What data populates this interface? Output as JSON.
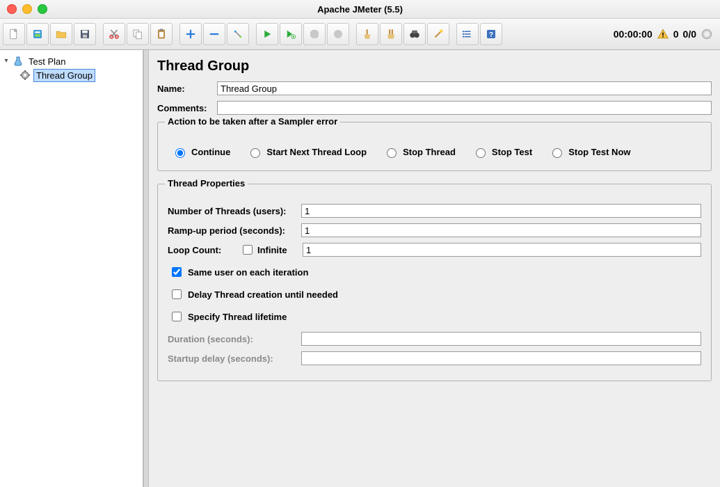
{
  "window": {
    "title": "Apache JMeter (5.5)"
  },
  "status": {
    "elapsed": "00:00:00",
    "warnings": "0",
    "threads": "0/0"
  },
  "tree": {
    "root": {
      "label": "Test Plan",
      "children": [
        {
          "label": "Thread Group"
        }
      ]
    }
  },
  "page": {
    "title": "Thread Group",
    "name_label": "Name:",
    "name_value": "Thread Group",
    "comments_label": "Comments:",
    "comments_value": "",
    "error_group": {
      "title": "Action to be taken after a Sampler error",
      "options": [
        "Continue",
        "Start Next Thread Loop",
        "Stop Thread",
        "Stop Test",
        "Stop Test Now"
      ]
    },
    "thread_group": {
      "title": "Thread Properties",
      "num_threads_label": "Number of Threads (users):",
      "num_threads_value": "1",
      "ramp_up_label": "Ramp-up period (seconds):",
      "ramp_up_value": "1",
      "loop_label": "Loop Count:",
      "infinite_label": "Infinite",
      "loop_value": "1",
      "same_user_label": "Same user on each iteration",
      "delay_creation_label": "Delay Thread creation until needed",
      "lifetime_label": "Specify Thread lifetime",
      "duration_label": "Duration (seconds):",
      "duration_value": "",
      "startup_delay_label": "Startup delay (seconds):",
      "startup_delay_value": ""
    }
  }
}
